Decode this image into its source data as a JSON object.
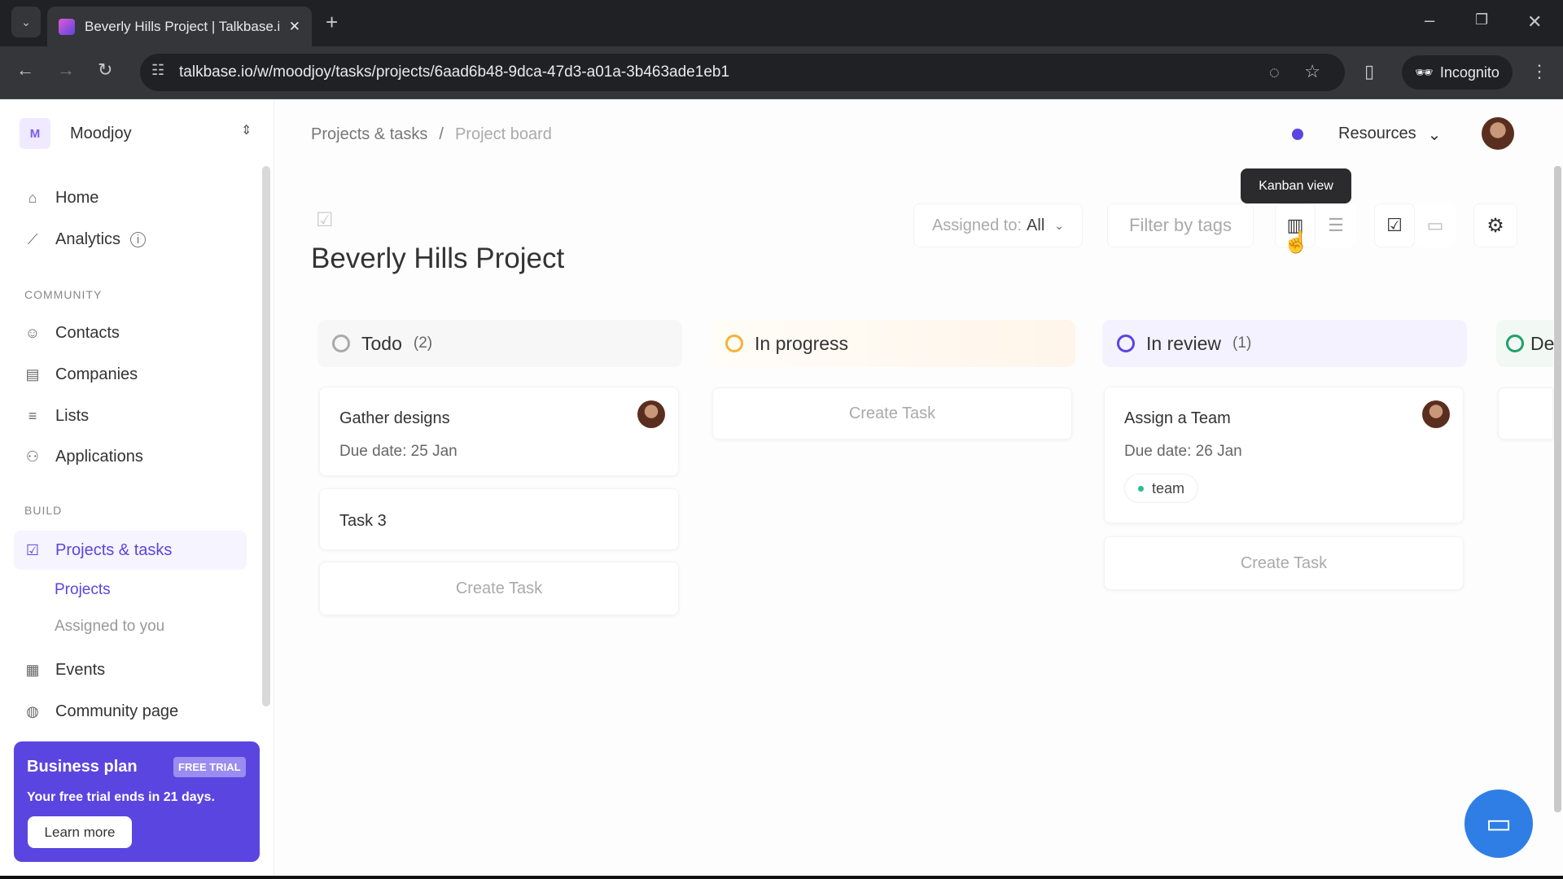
{
  "browser": {
    "tab_title": "Beverly Hills Project | Talkbase.io",
    "url": "talkbase.io/w/moodjoy/tasks/projects/6aad6b48-9dca-47d3-a01a-3b463ade1eb1",
    "incognito_label": "Incognito"
  },
  "sidebar": {
    "workspace_initial": "M",
    "workspace": "Moodjoy",
    "items": [
      {
        "label": "Home",
        "icon": "home-icon"
      },
      {
        "label": "Analytics",
        "icon": "chart-icon"
      }
    ],
    "community_label": "COMMUNITY",
    "community": [
      {
        "label": "Contacts"
      },
      {
        "label": "Companies"
      },
      {
        "label": "Lists"
      },
      {
        "label": "Applications"
      }
    ],
    "build_label": "BUILD",
    "build": {
      "projects_tasks": "Projects & tasks",
      "projects": "Projects",
      "assigned": "Assigned to you",
      "events": "Events",
      "community_page": "Community page"
    },
    "plan": {
      "title": "Business plan",
      "badge": "FREE TRIAL",
      "text": "Your free trial ends in 21 days.",
      "button": "Learn more",
      "color": "#5b45e0"
    }
  },
  "header": {
    "breadcrumb": [
      "Projects & tasks",
      "Project board"
    ],
    "resources": "Resources"
  },
  "toolbar": {
    "assigned_label": "Assigned to:",
    "assigned_value": "All",
    "filter_placeholder": "Filter by tags",
    "tooltip": "Kanban view"
  },
  "project": {
    "title": "Beverly Hills Project"
  },
  "columns": [
    {
      "name": "Todo",
      "count": "(2)",
      "color": "#aaaaaa",
      "cards": [
        {
          "title": "Gather designs",
          "due": "Due date: 25 Jan"
        },
        {
          "title": "Task 3"
        }
      ],
      "create": "Create Task"
    },
    {
      "name": "In progress",
      "count": "",
      "color": "#f5b335",
      "create": "Create Task"
    },
    {
      "name": "In review",
      "count": "(1)",
      "color": "#5b45e0",
      "cards": [
        {
          "title": "Assign a Team",
          "due": "Due date: 26 Jan",
          "tag": "team"
        }
      ],
      "create": "Create Task"
    },
    {
      "name": "De",
      "color": "#22a06b"
    }
  ]
}
